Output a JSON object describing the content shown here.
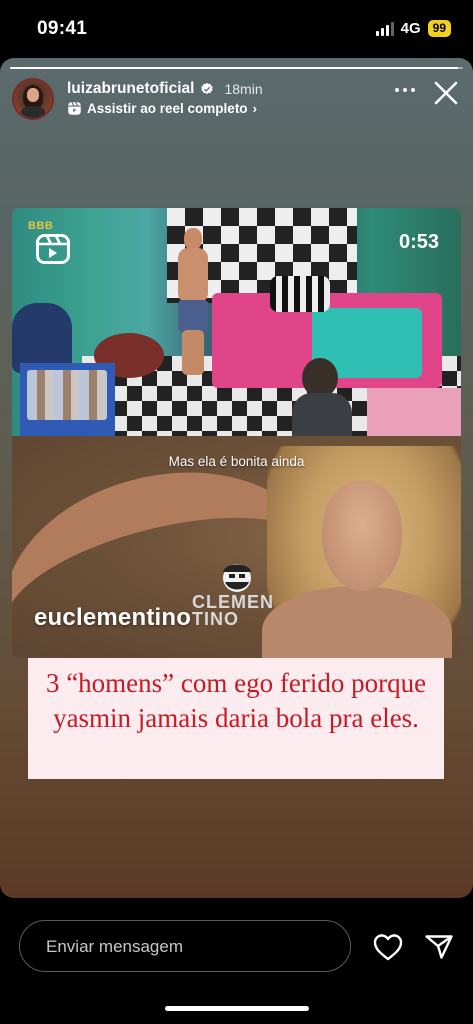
{
  "status_bar": {
    "time": "09:41",
    "network": "4G",
    "battery": "99"
  },
  "story": {
    "progress": 0.99,
    "header": {
      "username": "luizabrunetoficial",
      "time_ago": "18min",
      "reel_link": "Assistir ao reel completo",
      "chevron": "›"
    },
    "reel": {
      "duration": "0:53",
      "show_logo": "BBB"
    },
    "photo": {
      "caption": "Mas ela é bonita ainda",
      "watermark": "euclementino",
      "watermark_logo": "CLEMEN\nTINO"
    },
    "text": "3 “homens” com ego ferido porque yasmin jamais daria bola pra eles."
  },
  "footer": {
    "message_placeholder": "Enviar mensagem"
  },
  "colors": {
    "story_text": "#c81a25",
    "text_box": "#fcecef",
    "battery": "#f5cf1d"
  },
  "icons": [
    "reel-icon",
    "verified-icon",
    "more-icon",
    "close-icon",
    "heart-icon",
    "send-icon"
  ]
}
